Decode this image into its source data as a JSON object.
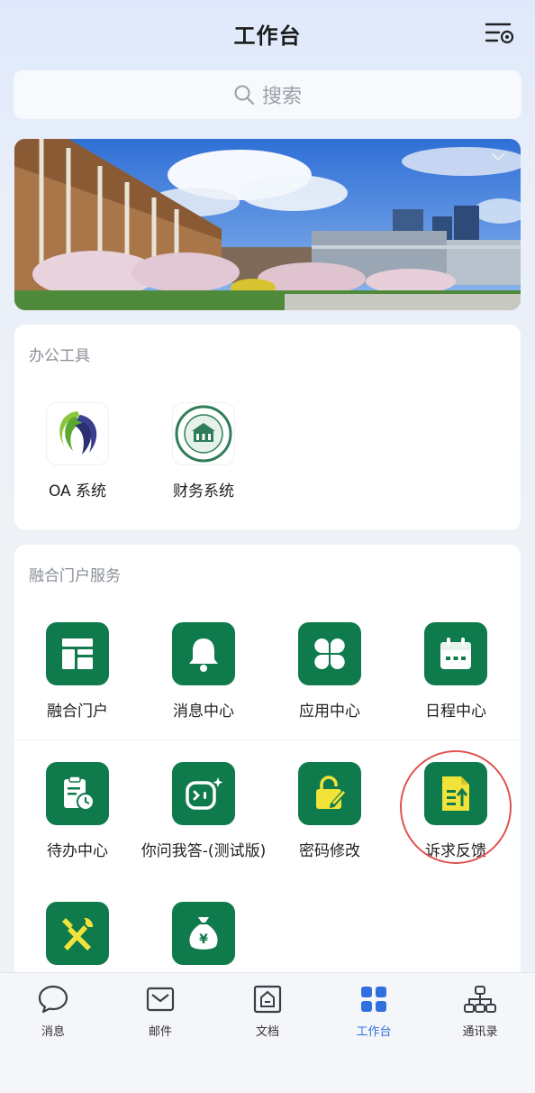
{
  "header": {
    "title": "工作台"
  },
  "search": {
    "placeholder": "搜索"
  },
  "office_tools": {
    "title": "办公工具",
    "apps": [
      {
        "label": "OA 系统",
        "icon": "oa-logo-icon"
      },
      {
        "label": "财务系统",
        "icon": "university-seal-icon"
      }
    ]
  },
  "portal_services": {
    "title": "融合门户服务",
    "apps": [
      {
        "label": "融合门户",
        "icon": "portal-layout-icon"
      },
      {
        "label": "消息中心",
        "icon": "bell-icon"
      },
      {
        "label": "应用中心",
        "icon": "clover-grid-icon"
      },
      {
        "label": "日程中心",
        "icon": "calendar-icon"
      },
      {
        "label": "待办中心",
        "icon": "clipboard-clock-icon"
      },
      {
        "label": "你问我答-(测试版)",
        "icon": "chatbot-icon"
      },
      {
        "label": "密码修改",
        "icon": "lock-edit-icon"
      },
      {
        "label": "诉求反馈",
        "icon": "document-upload-icon"
      },
      {
        "label": "",
        "icon": "tools-icon"
      },
      {
        "label": "",
        "icon": "money-bag-icon"
      }
    ]
  },
  "tabbar": {
    "items": [
      {
        "label": "消息",
        "icon": "chat-bubble-icon"
      },
      {
        "label": "邮件",
        "icon": "mail-icon"
      },
      {
        "label": "文档",
        "icon": "document-icon"
      },
      {
        "label": "工作台",
        "icon": "grid-icon",
        "active": true
      },
      {
        "label": "通讯录",
        "icon": "org-chart-icon"
      }
    ]
  },
  "colors": {
    "app_green": "#0f7a4b",
    "accent_yellow": "#f2e33a",
    "active_tab_blue": "#2f6fe0",
    "highlight_red": "#e0534f"
  }
}
